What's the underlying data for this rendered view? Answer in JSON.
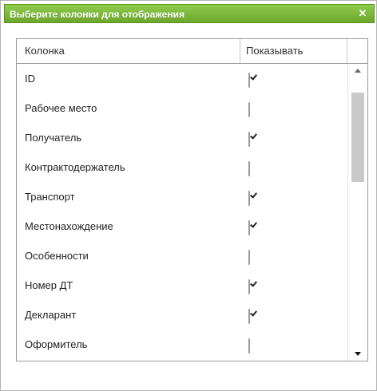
{
  "dialog": {
    "title": "Выберите колонки для отображения",
    "close_icon": "close-icon",
    "accent_color": "#7ab83a"
  },
  "grid": {
    "headers": {
      "column": "Колонка",
      "show": "Показывать"
    },
    "rows": [
      {
        "name": "ID",
        "checked": true
      },
      {
        "name": "Рабочее место",
        "checked": false
      },
      {
        "name": "Получатель",
        "checked": true
      },
      {
        "name": "Контрактодержатель",
        "checked": false
      },
      {
        "name": "Транспорт",
        "checked": true
      },
      {
        "name": "Местонахождение",
        "checked": true
      },
      {
        "name": "Особенности",
        "checked": false
      },
      {
        "name": "Номер ДТ",
        "checked": true
      },
      {
        "name": "Декларант",
        "checked": true
      },
      {
        "name": "Оформитель",
        "checked": false
      }
    ]
  }
}
